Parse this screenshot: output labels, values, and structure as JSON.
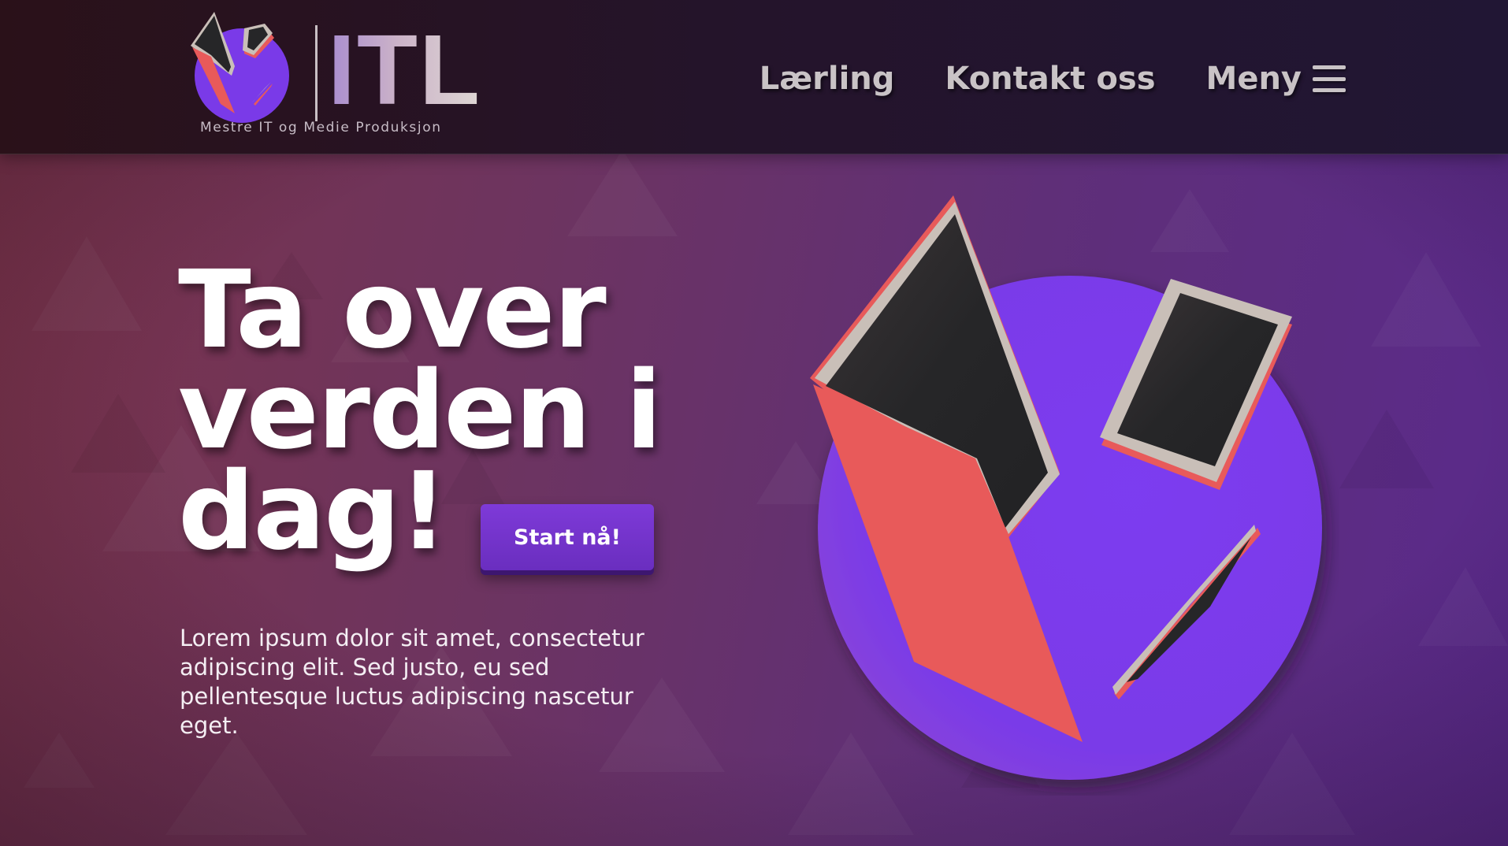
{
  "logo": {
    "text": "ITL",
    "tagline": "Mestre IT og Medie Produksjon"
  },
  "nav": {
    "items": [
      "Lærling",
      "Kontakt oss"
    ],
    "menu_label": "Meny",
    "menu_icon": "hamburger-icon"
  },
  "hero": {
    "title_lines": [
      "Ta over",
      "verden i",
      "dag!"
    ],
    "cta_label": "Start nå!",
    "body": "Lorem ipsum dolor sit amet, consectetur adipiscing elit. Sed justo, eu sed pellentesque luctus adipiscing nascetur eget."
  },
  "colors": {
    "accent_purple": "#7a3ae8",
    "coral": "#e85a5a",
    "dark_shard": "#262628",
    "silver_edge": "#c9bfb8",
    "cta": "#6a2ebf"
  }
}
